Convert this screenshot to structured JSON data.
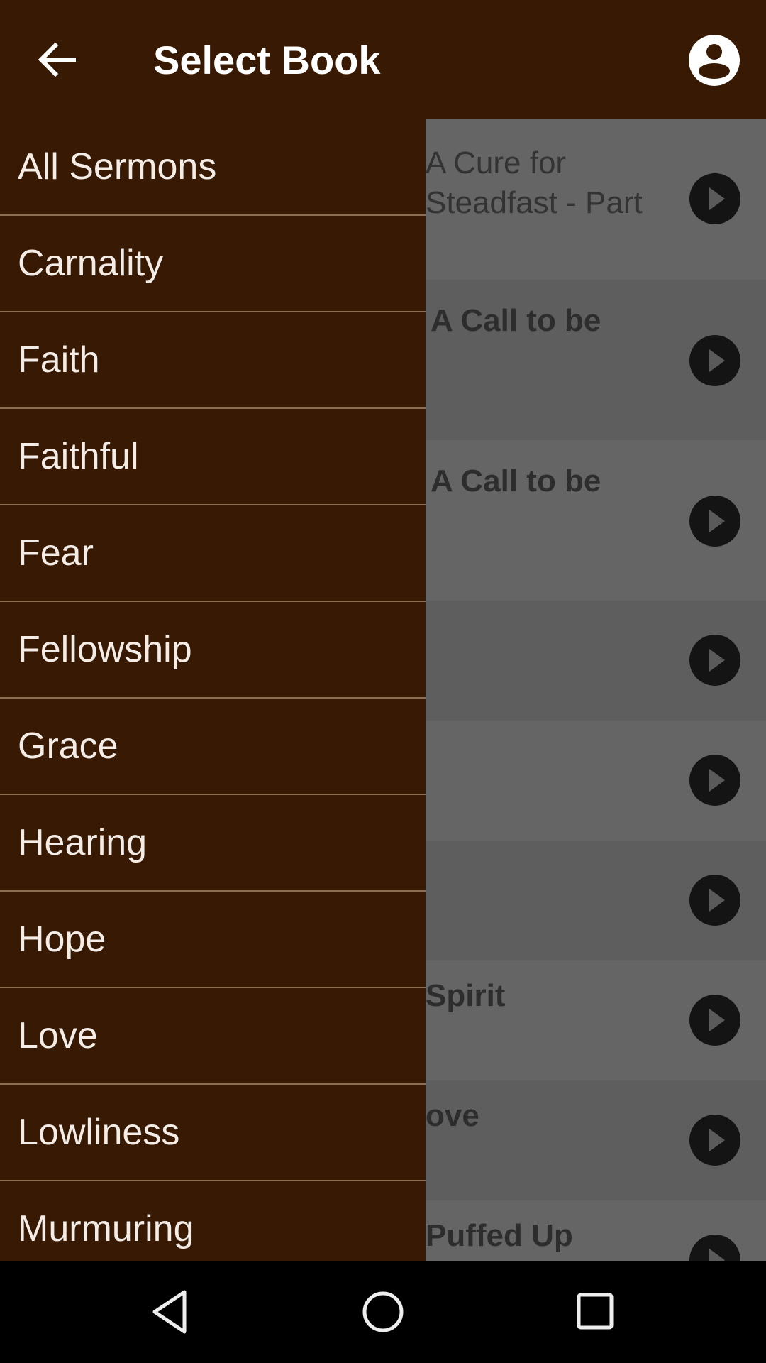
{
  "appbar": {
    "title": "Select Book",
    "back_icon": "arrow-left-icon",
    "account_icon": "account-circle-icon"
  },
  "drawer": {
    "items": [
      {
        "label": "All Sermons"
      },
      {
        "label": "Carnality"
      },
      {
        "label": "Faith"
      },
      {
        "label": "Faithful"
      },
      {
        "label": "Fear"
      },
      {
        "label": "Fellowship"
      },
      {
        "label": "Grace"
      },
      {
        "label": "Hearing"
      },
      {
        "label": "Hope"
      },
      {
        "label": "Love"
      },
      {
        "label": "Lowliness"
      },
      {
        "label": "Murmuring"
      }
    ]
  },
  "background_list": {
    "rows": [
      {
        "line1": "A Cure for",
        "line2": "Steadfast - Part",
        "bold": false
      },
      {
        "line1": "A Call to be",
        "line2": "",
        "bold": true
      },
      {
        "line1": "A Call to be",
        "line2": "",
        "bold": true
      },
      {
        "line1": "",
        "line2": "",
        "bold": false
      },
      {
        "line1": "",
        "line2": "",
        "bold": false
      },
      {
        "line1": "",
        "line2": "",
        "bold": false
      },
      {
        "line1": "Spirit",
        "line2": "",
        "bold": true
      },
      {
        "line1": "ove",
        "line2": "",
        "bold": true
      },
      {
        "line1": "Puffed Up",
        "line2": "",
        "bold": true
      }
    ],
    "play_icon": "play-circle-icon"
  },
  "navbar": {
    "back_icon": "nav-back-icon",
    "home_icon": "nav-home-icon",
    "recents_icon": "nav-recents-icon"
  },
  "colors": {
    "primary": "#381903",
    "divider": "#8a6f52",
    "drawer_text": "#f4ece6"
  }
}
